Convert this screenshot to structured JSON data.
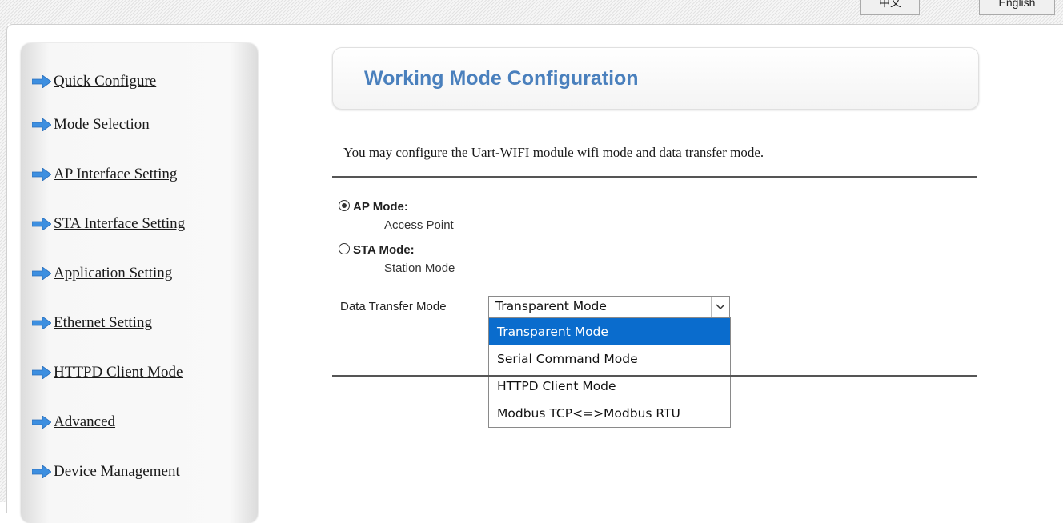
{
  "language_buttons": {
    "chinese": "中文",
    "english": "English"
  },
  "sidebar": {
    "items": [
      {
        "label": "Quick Configure"
      },
      {
        "label": "Mode Selection"
      },
      {
        "label": "AP Interface Setting"
      },
      {
        "label": "STA Interface Setting"
      },
      {
        "label": "Application Setting"
      },
      {
        "label": "Ethernet Setting"
      },
      {
        "label": "HTTPD Client Mode"
      },
      {
        "label": "Advanced"
      },
      {
        "label": "Device Management"
      }
    ],
    "arrow_icon": "right-arrow-icon",
    "arrow_color": "#3d8fe0"
  },
  "main": {
    "title": "Working Mode Configuration",
    "title_color": "#4a80bd",
    "description": "You may configure the Uart-WIFI module wifi mode and data transfer mode.",
    "wifi_modes": [
      {
        "label": "AP Mode:",
        "sublabel": "Access Point",
        "checked": true
      },
      {
        "label": "STA Mode:",
        "sublabel": "Station Mode",
        "checked": false
      }
    ],
    "data_transfer": {
      "label": "Data Transfer Mode",
      "selected": "Transparent Mode",
      "options": [
        "Transparent Mode",
        "Serial Command Mode",
        "HTTPD Client Mode",
        "Modbus TCP<=>Modbus RTU"
      ],
      "highlight_color": "#0a6ccd"
    }
  }
}
